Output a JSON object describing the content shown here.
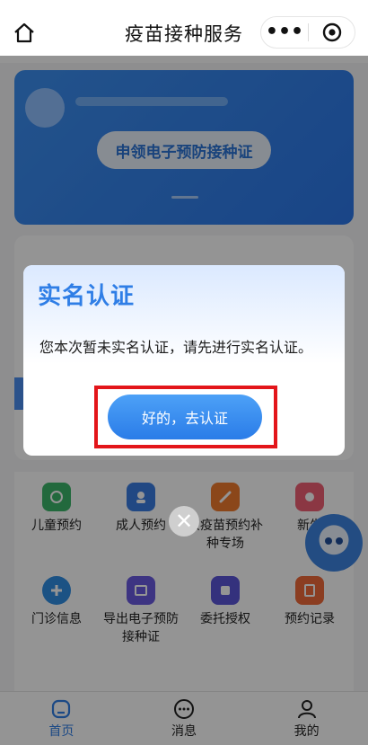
{
  "header": {
    "title": "疫苗接种服务",
    "more_label": "•••"
  },
  "hero": {
    "button_label": "申领电子预防接种证"
  },
  "grid": {
    "items": [
      {
        "label": "儿童预约",
        "color": "#3bb56a"
      },
      {
        "label": "成人预约",
        "color": "#3a7de2"
      },
      {
        "label": "灰疫苗预约补种专场",
        "color": "#f07a2e"
      },
      {
        "label": "新生",
        "color": "#ef5f74"
      },
      {
        "label": "门诊信息",
        "color": "#2f8de4"
      },
      {
        "label": "导出电子预防接种证",
        "color": "#6a5be0"
      },
      {
        "label": "委托授权",
        "color": "#5a55d8"
      },
      {
        "label": "预约记录",
        "color": "#f06a3a"
      }
    ]
  },
  "tabbar": {
    "tabs": [
      {
        "label": "首页",
        "active": true
      },
      {
        "label": "消息",
        "active": false
      },
      {
        "label": "我的",
        "active": false
      }
    ]
  },
  "dialog": {
    "title": "实名认证",
    "message": "您本次暂未实名认证，请先进行实名认证。",
    "confirm_label": "好的，去认证"
  },
  "colors": {
    "accent": "#2f7ee6",
    "highlight": "#e3151a",
    "mask": "rgba(0,0,0,0.42)"
  }
}
